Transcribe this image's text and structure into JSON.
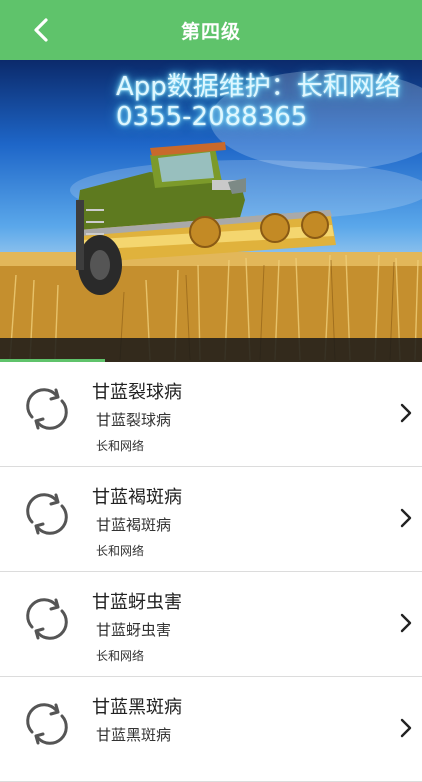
{
  "header": {
    "title": "第四级"
  },
  "banner": {
    "line1": "App数据维护：长和网络",
    "line2": "0355-2088365"
  },
  "items": [
    {
      "title": "甘蓝裂球病",
      "subtitle": "甘蓝裂球病",
      "source": "长和网络"
    },
    {
      "title": "甘蓝褐斑病",
      "subtitle": "甘蓝褐斑病",
      "source": "长和网络"
    },
    {
      "title": "甘蓝蚜虫害",
      "subtitle": "甘蓝蚜虫害",
      "source": "长和网络"
    },
    {
      "title": "甘蓝黑斑病",
      "subtitle": "甘蓝黑斑病",
      "source": ""
    }
  ],
  "colors": {
    "accent": "#5fc36b"
  },
  "icons": {
    "back": "chevron-left-icon",
    "item": "refresh-icon",
    "arrow": "chevron-right-icon"
  }
}
